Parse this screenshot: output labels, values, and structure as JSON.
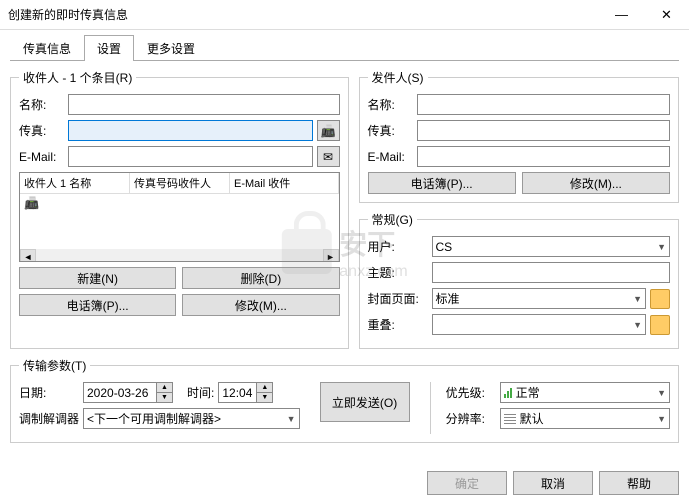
{
  "window": {
    "title": "创建新的即时传真信息",
    "minimize": "—",
    "close": "✕"
  },
  "tabs": {
    "items": [
      {
        "label": "传真信息"
      },
      {
        "label": "设置"
      },
      {
        "label": "更多设置"
      }
    ],
    "active": 1
  },
  "recipients": {
    "legend": "收件人 - 1 个条目(R)",
    "name_label": "名称:",
    "name_value": "",
    "fax_label": "传真:",
    "fax_value": "",
    "email_label": "E-Mail:",
    "email_value": "",
    "list_headers": {
      "col1": "收件人 1 名称",
      "col2": "传真号码收件人",
      "col3": "E-Mail 收件"
    },
    "buttons": {
      "new": "新建(N)",
      "delete": "删除(D)",
      "phonebook": "电话簿(P)...",
      "modify": "修改(M)..."
    }
  },
  "sender": {
    "legend": "发件人(S)",
    "name_label": "名称:",
    "name_value": "",
    "fax_label": "传真:",
    "fax_value": "",
    "email_label": "E-Mail:",
    "email_value": "",
    "buttons": {
      "phonebook": "电话簿(P)...",
      "modify": "修改(M)..."
    }
  },
  "general": {
    "legend": "常规(G)",
    "user_label": "用户:",
    "user_value": "CS",
    "subject_label": "主题:",
    "subject_value": "",
    "cover_label": "封面页面:",
    "cover_value": "标准",
    "overlay_label": "重叠:",
    "overlay_value": ""
  },
  "transmission": {
    "legend": "传输参数(T)",
    "date_label": "日期:",
    "date_value": "2020-03-26",
    "time_label": "时间:",
    "time_value": "12:04",
    "modem_label": "调制解调器",
    "modem_value": "<下一个可用调制解调器>",
    "send_now": "立即发送(O)",
    "priority_label": "优先级:",
    "priority_value": "正常",
    "resolution_label": "分辨率:",
    "resolution_value": "默认"
  },
  "footer": {
    "ok": "确定",
    "cancel": "取消",
    "help": "帮助"
  },
  "watermark": {
    "text": "安下",
    "url": "anxz.com"
  }
}
